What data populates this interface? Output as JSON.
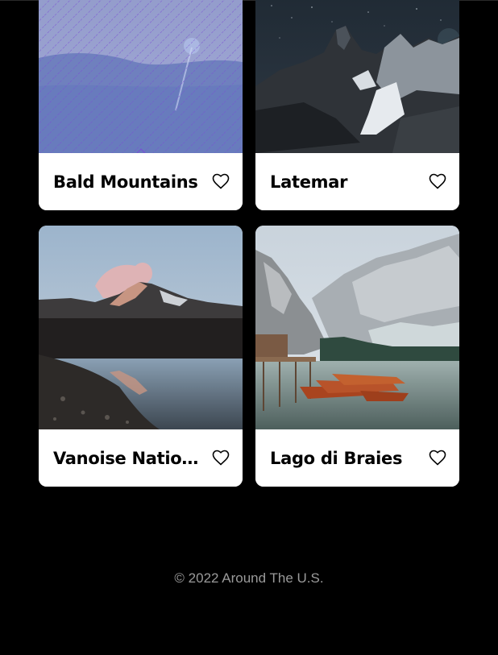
{
  "cards": [
    {
      "title": "Bald Mountains",
      "like_icon": "heart-outline-icon",
      "liked": false
    },
    {
      "title": "Latemar",
      "like_icon": "heart-outline-icon",
      "liked": false
    },
    {
      "title": "Vanoise National Park",
      "like_icon": "heart-outline-icon",
      "liked": false
    },
    {
      "title": "Lago di Braies",
      "like_icon": "heart-outline-icon",
      "liked": false
    }
  ],
  "footer": {
    "copyright": "© 2022 Around The U.S."
  },
  "colors": {
    "background": "#000000",
    "card": "#ffffff",
    "title_text": "#000000",
    "footer_text": "#9a9a9a",
    "placeholder_stripes": "#7b4dd6"
  }
}
